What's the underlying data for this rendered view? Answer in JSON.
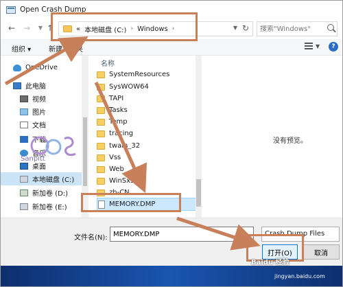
{
  "window": {
    "title": "Open Crash Dump"
  },
  "address": {
    "prefix": "«",
    "crumbs": [
      "本地磁盘 (C:)",
      "Windows"
    ],
    "separator": "›"
  },
  "search": {
    "placeholder": "搜索\"Windows\""
  },
  "toolbar": {
    "organize_label": "组织 ▾",
    "new_folder_label": "新建文件夹"
  },
  "navpane": {
    "items": [
      {
        "label": "OneDrive",
        "icon": "cloud-icon"
      },
      {
        "label": "此电脑",
        "icon": "computer-icon"
      },
      {
        "label": "视频",
        "icon": "video-icon"
      },
      {
        "label": "图片",
        "icon": "pictures-icon"
      },
      {
        "label": "文档",
        "icon": "documents-icon"
      },
      {
        "label": "下载",
        "icon": "downloads-icon"
      },
      {
        "label": "音乐",
        "icon": "music-icon"
      },
      {
        "label": "桌面",
        "icon": "desktop-icon"
      },
      {
        "label": "本地磁盘 (C:)",
        "icon": "drive-icon"
      },
      {
        "label": "新加卷 (D:)",
        "icon": "drive-icon"
      },
      {
        "label": "新加卷 (E:)",
        "icon": "drive-icon"
      }
    ]
  },
  "filelist": {
    "column_header": "名称",
    "items": [
      {
        "name": "SystemResources",
        "type": "folder"
      },
      {
        "name": "SysWOW64",
        "type": "folder"
      },
      {
        "name": "TAPI",
        "type": "folder"
      },
      {
        "name": "Tasks",
        "type": "folder"
      },
      {
        "name": "Temp",
        "type": "folder"
      },
      {
        "name": "tracing",
        "type": "folder"
      },
      {
        "name": "twain_32",
        "type": "folder"
      },
      {
        "name": "Vss",
        "type": "folder"
      },
      {
        "name": "Web",
        "type": "folder"
      },
      {
        "name": "WinSxS",
        "type": "folder"
      },
      {
        "name": "zh-CN",
        "type": "folder"
      },
      {
        "name": "MEMORY.DMP",
        "type": "file"
      }
    ],
    "selected": "MEMORY.DMP"
  },
  "preview": {
    "empty_text": "没有预览。"
  },
  "bottom": {
    "filename_label": "文件名(N):",
    "filename_value": "MEMORY.DMP",
    "filter_label": "Crash Dump Files",
    "open_label": "打开(O)",
    "cancel_label": "取消"
  },
  "watermark": {
    "text": "Sanpitt",
    "footer": "Baidu 经验",
    "url": "jingyan.baidu.com"
  },
  "colors": {
    "selection": "#cce8ff",
    "accent": "#0078d7",
    "annotation": "#c8805a"
  }
}
